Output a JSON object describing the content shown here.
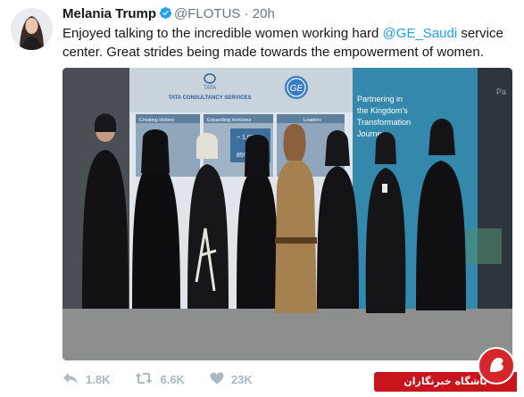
{
  "tweet": {
    "author_name": "Melania Trump",
    "handle": "@FLOTUS",
    "separator": "·",
    "time": "20h",
    "text_before": "Enjoyed talking to the incredible women working hard ",
    "mention": "@GE_Saudi",
    "text_after": " service center. Great strides being made towards the empowerment of women.",
    "verified": true,
    "accent_color": "#1da1f2"
  },
  "media": {
    "sign_tata_wordmark": "TATA",
    "sign_tcs": "TATA CONSULTANCY SERVICES",
    "panel_1": "Creating History",
    "panel_2": "Expanding Horizons",
    "panel_3": "Leaders",
    "stat_1": "~ 1,000",
    "stat_2": "85%",
    "banner_line_1": "Partnering in",
    "banner_line_2": "the Kingdom's",
    "banner_line_3": "Transformation",
    "banner_line_4": "Journey",
    "edge_text": "Pa"
  },
  "actions": {
    "reply_count": "1.8K",
    "retweet_count": "6.6K",
    "like_count": "23K",
    "icons": [
      "reply-icon",
      "retweet-icon",
      "like-icon"
    ]
  },
  "watermark": {
    "label": "باشگاه خبرنگاران",
    "color": "#c8151d"
  }
}
